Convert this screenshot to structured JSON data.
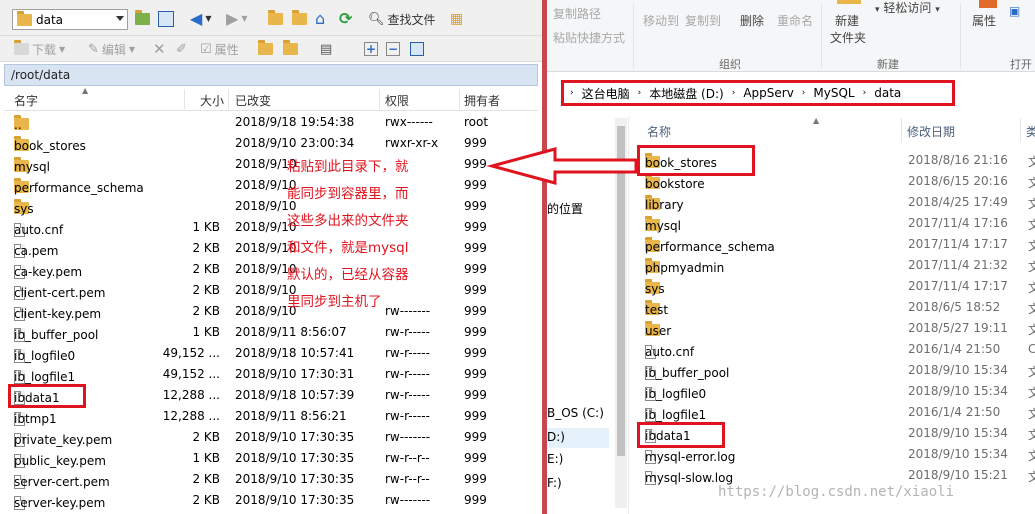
{
  "left": {
    "toolbar1": {
      "combo_value": "data",
      "find_files_label": "查找文件"
    },
    "toolbar2": {
      "download_label": "下载",
      "edit_label": "编辑",
      "properties_label": "属性"
    },
    "path": "/root/data",
    "columns": {
      "name": "名字",
      "size": "大小",
      "modified": "已改变",
      "perms": "权限",
      "owner": "拥有者"
    },
    "rows": [
      {
        "name": "..",
        "type": "up",
        "size": "",
        "date": "2018/9/18 19:54:38",
        "perm": "rwx------",
        "owner": "root"
      },
      {
        "name": "book_stores",
        "type": "folder",
        "size": "",
        "date": "2018/9/10 23:00:34",
        "perm": "rwxr-xr-x",
        "owner": "999"
      },
      {
        "name": "mysql",
        "type": "folder",
        "size": "",
        "date": "2018/9/10",
        "perm": "",
        "owner": "999"
      },
      {
        "name": "performance_schema",
        "type": "folder",
        "size": "",
        "date": "2018/9/10",
        "perm": "",
        "owner": "999"
      },
      {
        "name": "sys",
        "type": "folder",
        "size": "",
        "date": "2018/9/10",
        "perm": "",
        "owner": "999"
      },
      {
        "name": "auto.cnf",
        "type": "file",
        "size": "1 KB",
        "date": "2018/9/10",
        "perm": "",
        "owner": "999"
      },
      {
        "name": "ca.pem",
        "type": "file",
        "size": "2 KB",
        "date": "2018/9/10",
        "perm": "",
        "owner": "999"
      },
      {
        "name": "ca-key.pem",
        "type": "file",
        "size": "2 KB",
        "date": "2018/9/10",
        "perm": "",
        "owner": "999"
      },
      {
        "name": "client-cert.pem",
        "type": "file",
        "size": "2 KB",
        "date": "2018/9/10",
        "perm": "",
        "owner": "999"
      },
      {
        "name": "client-key.pem",
        "type": "file",
        "size": "2 KB",
        "date": "2018/9/10",
        "perm": "rw-------",
        "owner": "999"
      },
      {
        "name": "ib_buffer_pool",
        "type": "file",
        "size": "1 KB",
        "date": "2018/9/11 8:56:07",
        "perm": "rw-r-----",
        "owner": "999"
      },
      {
        "name": "ib_logfile0",
        "type": "file",
        "size": "49,152 ...",
        "date": "2018/9/18 10:57:41",
        "perm": "rw-r-----",
        "owner": "999"
      },
      {
        "name": "ib_logfile1",
        "type": "file",
        "size": "49,152 ...",
        "date": "2018/9/10 17:30:31",
        "perm": "rw-r-----",
        "owner": "999"
      },
      {
        "name": "ibdata1",
        "type": "file",
        "size": "12,288 ...",
        "date": "2018/9/18 10:57:39",
        "perm": "rw-r-----",
        "owner": "999"
      },
      {
        "name": "ibtmp1",
        "type": "file",
        "size": "12,288 ...",
        "date": "2018/9/11 8:56:21",
        "perm": "rw-r-----",
        "owner": "999"
      },
      {
        "name": "private_key.pem",
        "type": "file",
        "size": "2 KB",
        "date": "2018/9/10 17:30:35",
        "perm": "rw-------",
        "owner": "999"
      },
      {
        "name": "public_key.pem",
        "type": "file",
        "size": "1 KB",
        "date": "2018/9/10 17:30:35",
        "perm": "rw-r--r--",
        "owner": "999"
      },
      {
        "name": "server-cert.pem",
        "type": "file",
        "size": "2 KB",
        "date": "2018/9/10 17:30:35",
        "perm": "rw-r--r--",
        "owner": "999"
      },
      {
        "name": "server-key.pem",
        "type": "file",
        "size": "2 KB",
        "date": "2018/9/10 17:30:35",
        "perm": "rw-------",
        "owner": "999"
      }
    ]
  },
  "annotation": [
    "粘贴到此目录下，就",
    "能同步到容器里，而",
    "这些多出来的文件夹",
    "和文件，就是mysql",
    "默认的，已经从容器",
    "里同步到主机了"
  ],
  "right": {
    "ribbon": {
      "copy_path": "复制路径",
      "paste_shortcut": "粘贴快捷方式",
      "move_to": "移动到",
      "copy_to": "复制到",
      "delete": "删除",
      "rename": "重命名",
      "new_folder_1": "新建",
      "new_folder_2": "文件夹",
      "easy_access": "轻松访问",
      "properties": "属性",
      "open": "打开",
      "group_organize": "组织",
      "group_new": "新建",
      "group_open": "打开"
    },
    "breadcrumb": [
      "这台电脑",
      "本地磁盘 (D:)",
      "AppServ",
      "MySQL",
      "data"
    ],
    "nav": [
      {
        "label": "的位置",
        "selected": false
      },
      {
        "label": "B_OS (C:)",
        "selected": false
      },
      {
        "label": "D:)",
        "selected": true
      },
      {
        "label": "E:)",
        "selected": false
      },
      {
        "label": "F:)",
        "selected": false
      }
    ],
    "columns": {
      "name": "名称",
      "modified": "修改日期",
      "type": "类"
    },
    "rows": [
      {
        "name": "book_stores",
        "type": "folder",
        "date": "2018/8/16 21:16",
        "kind": "文"
      },
      {
        "name": "bookstore",
        "type": "folder",
        "date": "2018/6/15 20:16",
        "kind": "文"
      },
      {
        "name": "library",
        "type": "folder",
        "date": "2018/4/25 17:49",
        "kind": "文"
      },
      {
        "name": "mysql",
        "type": "folder",
        "date": "2017/11/4 17:16",
        "kind": "文"
      },
      {
        "name": "performance_schema",
        "type": "folder",
        "date": "2017/11/4 17:17",
        "kind": "文"
      },
      {
        "name": "phpmyadmin",
        "type": "folder",
        "date": "2017/11/4 21:32",
        "kind": "文"
      },
      {
        "name": "sys",
        "type": "folder",
        "date": "2017/11/4 17:17",
        "kind": "文"
      },
      {
        "name": "test",
        "type": "folder",
        "date": "2018/6/5 18:52",
        "kind": "文"
      },
      {
        "name": "user",
        "type": "folder",
        "date": "2018/5/27 19:11",
        "kind": "文"
      },
      {
        "name": "auto.cnf",
        "type": "file",
        "date": "2016/1/4 21:50",
        "kind": "C"
      },
      {
        "name": "ib_buffer_pool",
        "type": "file",
        "date": "2018/9/10 15:34",
        "kind": "文"
      },
      {
        "name": "ib_logfile0",
        "type": "file",
        "date": "2018/9/10 15:34",
        "kind": "文"
      },
      {
        "name": "ib_logfile1",
        "type": "file",
        "date": "2016/1/4 21:50",
        "kind": "文"
      },
      {
        "name": "ibdata1",
        "type": "file",
        "date": "2018/9/10 15:34",
        "kind": "文"
      },
      {
        "name": "mysql-error.log",
        "type": "file",
        "date": "2018/9/10 15:34",
        "kind": "文"
      },
      {
        "name": "mysql-slow.log",
        "type": "file",
        "date": "2018/9/10 15:21",
        "kind": "文"
      }
    ]
  },
  "watermark": "https://blog.csdn.net/xiaoli",
  "colors": {
    "highlight_red": "#e0141e",
    "divider": "#c8464e",
    "folder": "#e8b64b"
  }
}
